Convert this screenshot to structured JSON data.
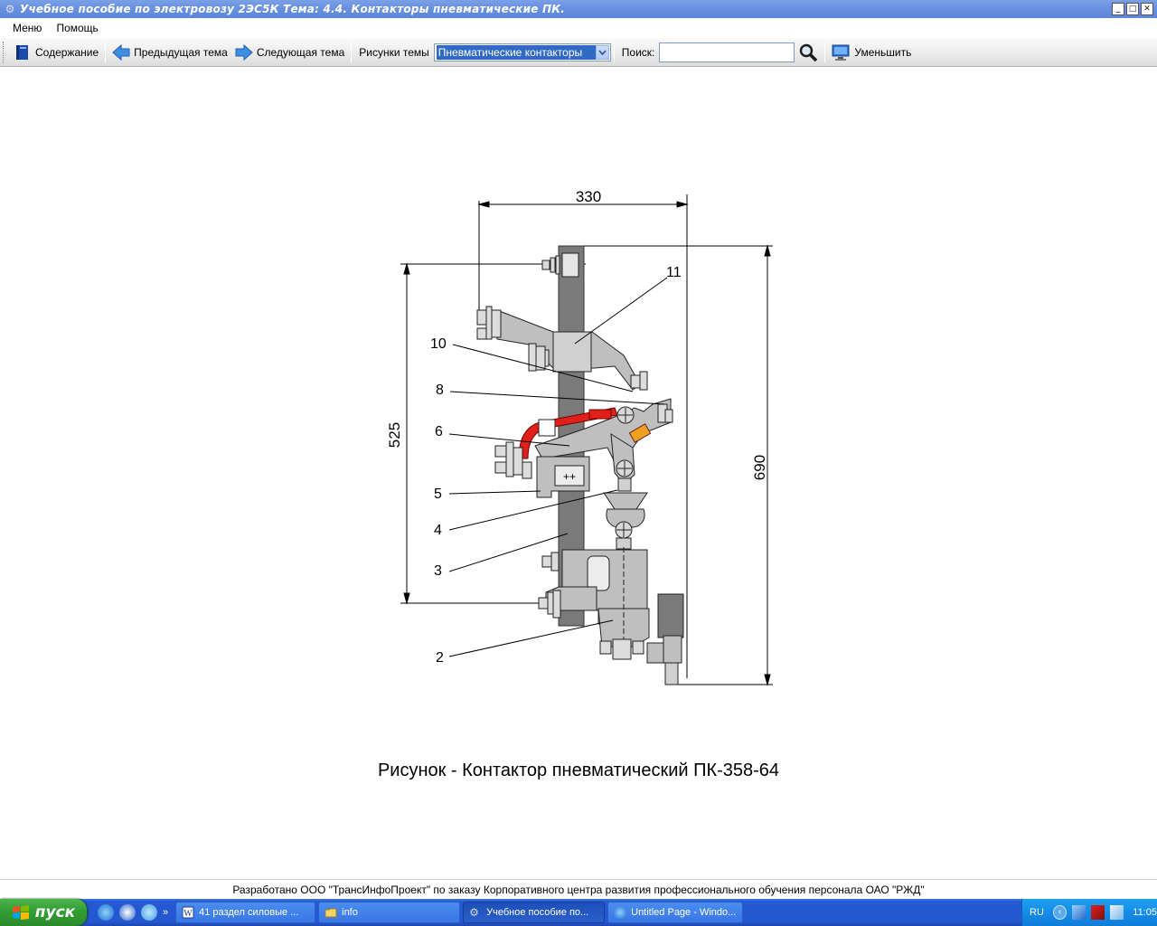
{
  "window": {
    "title": "Учебное пособие по электровозу 2ЭС5К Тема: 4.4. Контакторы пневматические ПК.",
    "minimize": "_",
    "maximize": "□",
    "close": "✕"
  },
  "menu": {
    "items": [
      "Меню",
      "Помощь"
    ]
  },
  "toolbar": {
    "contents_label": "Содержание",
    "prev_label": "Предыдущая тема",
    "next_label": "Следующая тема",
    "figures_label": "Рисунки темы",
    "figures_selected": "Пневматические контакторы",
    "search_label": "Поиск:",
    "search_value": "",
    "shrink_label": "Уменьшить"
  },
  "figure": {
    "dim_width": "330",
    "dim_height_left": "525",
    "dim_height_right": "690",
    "callouts": [
      "11",
      "10",
      "8",
      "6",
      "5",
      "4",
      "3",
      "2"
    ],
    "caption": "Рисунок - Контактор пневматический ПК-358-64"
  },
  "footer": {
    "text": "Разработано ООО \"ТрансИнфоПроект\" по заказу Корпоративного центра развития профессионального обучения персонала ОАО \"РЖД\""
  },
  "taskbar": {
    "start_label": "пуск",
    "tasks": [
      "41 раздел силовые ...",
      "info",
      "Учебное пособие по...",
      "Untitled Page - Windo..."
    ],
    "language": "RU",
    "clock": "11:05",
    "colors": {
      "taskbar": "#2557d0",
      "start": "#34a034",
      "tray": "#148ce8"
    }
  },
  "icons": {
    "app": "gear-icon",
    "contents": "book-icon",
    "prev": "arrow-left-icon",
    "next": "arrow-right-icon",
    "search": "magnifier-icon",
    "shrink": "monitor-icon"
  },
  "colors": {
    "titlebar": "#6a92e0",
    "selection": "#316ac5",
    "arc_chute": "#e0201a",
    "part_fill": "#bfbfbf",
    "frame_fill": "#7a7a7a"
  }
}
